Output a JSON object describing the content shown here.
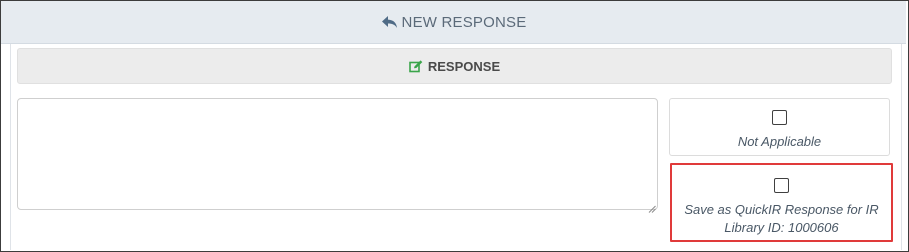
{
  "header": {
    "title": "NEW RESPONSE",
    "icon": "reply-icon"
  },
  "response_section": {
    "title": "RESPONSE",
    "icon": "edit-icon",
    "icon_color": "#3aa54a"
  },
  "response_input": {
    "value": "",
    "placeholder": ""
  },
  "options": {
    "not_applicable": {
      "label": "Not Applicable",
      "checked": false
    },
    "save_quickir": {
      "label": "Save as QuickIR Response for IR Library ID: 1000606",
      "checked": false,
      "highlight_color": "#e03a3a"
    }
  }
}
